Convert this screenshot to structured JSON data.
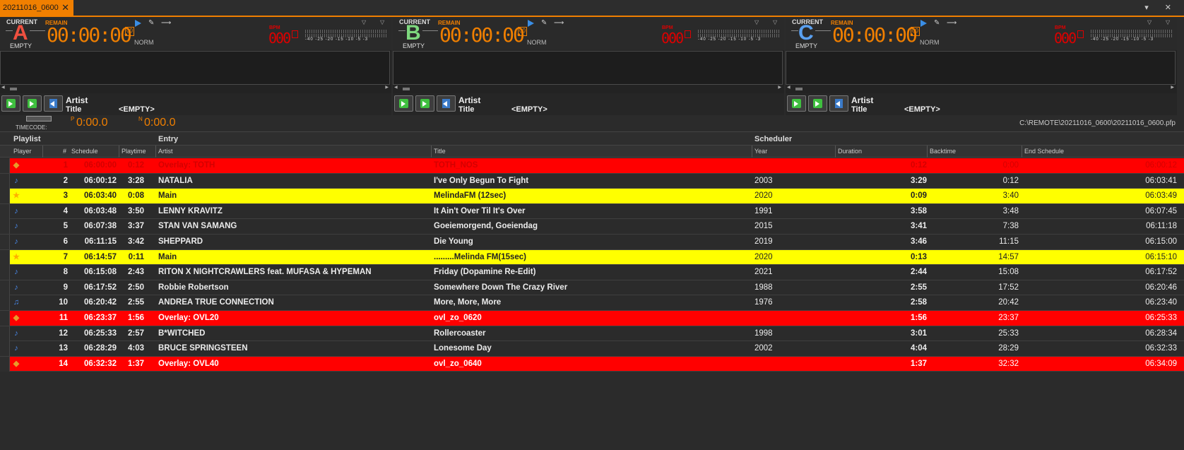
{
  "tab": {
    "label": "20211016_0600",
    "close": "✕"
  },
  "tabbar_right": "▾ ✕",
  "decks": [
    {
      "current": "CURRENT",
      "remain": "REMAIN",
      "letter": "A",
      "letter_color": "#f05040",
      "empty": "EMPTY",
      "time": "00:00:00",
      "frames": "00",
      "norm": "NORM",
      "bpm_label": "BPM",
      "bpm": "000",
      "vu_scale": "-40 -25 -20 -15 -10 -5 -3",
      "artist_label": "Artist",
      "title_label": "Title",
      "title_value": "<EMPTY>"
    },
    {
      "current": "CURRENT",
      "remain": "REMAIN",
      "letter": "B",
      "letter_color": "#7ed87e",
      "empty": "EMPTY",
      "time": "00:00:00",
      "frames": "00",
      "norm": "NORM",
      "bpm_label": "BPM",
      "bpm": "000",
      "vu_scale": "-40 -25 -20 -15 -10 -5 -3",
      "artist_label": "Artist",
      "title_label": "Title",
      "title_value": "<EMPTY>"
    },
    {
      "current": "CURRENT",
      "remain": "REMAIN",
      "letter": "C",
      "letter_color": "#5aa0f0",
      "empty": "EMPTY",
      "time": "00:00:00",
      "frames": "00",
      "norm": "NORM",
      "bpm_label": "BPM",
      "bpm": "000",
      "vu_scale": "-40 -25 -20 -15 -10 -5 -3",
      "artist_label": "Artist",
      "title_label": "Title",
      "title_value": "<EMPTY>"
    }
  ],
  "timecode": {
    "label": "TIMECODE:",
    "p_label": "P",
    "p_value": "0:00.0",
    "n_label": "N",
    "n_value": "0:00.0"
  },
  "path": "C:\\REMOTE\\20211016_0600\\20211016_0600.pfp",
  "groups": {
    "playlist": "Playlist",
    "entry": "Entry",
    "scheduler": "Scheduler"
  },
  "columns": {
    "player": "Player",
    "num": "#",
    "schedule": "Schedule",
    "playtime": "Playtime",
    "artist": "Artist",
    "title": "Title",
    "year": "Year",
    "duration": "Duration",
    "backtime": "Backtime",
    "end": "End Schedule"
  },
  "rows": [
    {
      "style": "played",
      "icon": "box",
      "num": "1",
      "sched": "06:00:00",
      "ptime": "0:12",
      "artist": "Overlay: TOTH",
      "title": "TOTH_NOS",
      "year": "",
      "dur": "0:12",
      "back": "0:00",
      "end": "06:00:12"
    },
    {
      "style": "white",
      "icon": "music",
      "num": "2",
      "sched": "06:00:12",
      "ptime": "3:28",
      "artist": "NATALIA",
      "title": "I've Only Begun To Fight",
      "year": "2003",
      "dur": "3:29",
      "back": "0:12",
      "end": "06:03:41"
    },
    {
      "style": "yellow",
      "icon": "star",
      "num": "3",
      "sched": "06:03:40",
      "ptime": "0:08",
      "artist": "Main",
      "title": "MelindaFM (12sec)",
      "year": "2020",
      "dur": "0:09",
      "back": "3:40",
      "end": "06:03:49"
    },
    {
      "style": "white",
      "icon": "music",
      "num": "4",
      "sched": "06:03:48",
      "ptime": "3:50",
      "artist": "LENNY KRAVITZ",
      "title": "It Ain't Over Til It's Over",
      "year": "1991",
      "dur": "3:58",
      "back": "3:48",
      "end": "06:07:45"
    },
    {
      "style": "white",
      "icon": "music-star",
      "num": "5",
      "sched": "06:07:38",
      "ptime": "3:37",
      "artist": "STAN VAN SAMANG",
      "title": "Goeiemorgend, Goeiendag",
      "year": "2015",
      "dur": "3:41",
      "back": "7:38",
      "end": "06:11:18"
    },
    {
      "style": "white",
      "icon": "music",
      "num": "6",
      "sched": "06:11:15",
      "ptime": "3:42",
      "artist": "SHEPPARD",
      "title": "Die Young",
      "year": "2019",
      "dur": "3:46",
      "back": "11:15",
      "end": "06:15:00"
    },
    {
      "style": "yellow",
      "icon": "star",
      "num": "7",
      "sched": "06:14:57",
      "ptime": "0:11",
      "artist": "Main",
      "title": ".........Melinda FM(15sec)",
      "year": "2020",
      "dur": "0:13",
      "back": "14:57",
      "end": "06:15:10"
    },
    {
      "style": "white",
      "icon": "music-star",
      "num": "8",
      "sched": "06:15:08",
      "ptime": "2:43",
      "artist": "RITON X NIGHTCRAWLERS feat. MUFASA & HYPEMAN",
      "title": "Friday (Dopamine Re-Edit)",
      "year": "2021",
      "dur": "2:44",
      "back": "15:08",
      "end": "06:17:52"
    },
    {
      "style": "white",
      "icon": "music",
      "num": "9",
      "sched": "06:17:52",
      "ptime": "2:50",
      "artist": "Robbie Robertson",
      "title": "Somewhere Down The Crazy River",
      "year": "1988",
      "dur": "2:55",
      "back": "17:52",
      "end": "06:20:46"
    },
    {
      "style": "white",
      "icon": "music2",
      "num": "10",
      "sched": "06:20:42",
      "ptime": "2:55",
      "artist": "ANDREA TRUE CONNECTION",
      "title": "More, More, More",
      "year": "1976",
      "dur": "2:58",
      "back": "20:42",
      "end": "06:23:40"
    },
    {
      "style": "red",
      "icon": "box",
      "num": "11",
      "sched": "06:23:37",
      "ptime": "1:56",
      "artist": "Overlay: OVL20",
      "title": "ovl_zo_0620",
      "year": "",
      "dur": "1:56",
      "back": "23:37",
      "end": "06:25:33"
    },
    {
      "style": "white",
      "icon": "music",
      "num": "12",
      "sched": "06:25:33",
      "ptime": "2:57",
      "artist": "B*WITCHED",
      "title": "Rollercoaster",
      "year": "1998",
      "dur": "3:01",
      "back": "25:33",
      "end": "06:28:34"
    },
    {
      "style": "white",
      "icon": "music",
      "num": "13",
      "sched": "06:28:29",
      "ptime": "4:03",
      "artist": "BRUCE SPRINGSTEEN",
      "title": "Lonesome Day",
      "year": "2002",
      "dur": "4:04",
      "back": "28:29",
      "end": "06:32:33"
    },
    {
      "style": "red",
      "icon": "box",
      "num": "14",
      "sched": "06:32:32",
      "ptime": "1:37",
      "artist": "Overlay: OVL40",
      "title": "ovl_zo_0640",
      "year": "",
      "dur": "1:37",
      "back": "32:32",
      "end": "06:34:09"
    }
  ]
}
